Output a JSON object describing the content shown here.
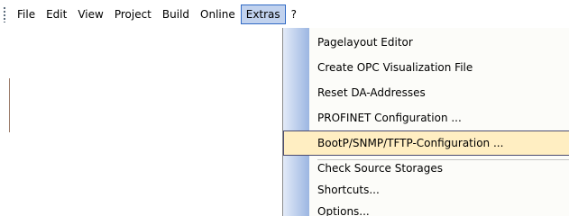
{
  "menubar": {
    "items": [
      {
        "label": "File"
      },
      {
        "label": "Edit"
      },
      {
        "label": "View"
      },
      {
        "label": "Project"
      },
      {
        "label": "Build"
      },
      {
        "label": "Online"
      },
      {
        "label": "Extras",
        "active": true
      },
      {
        "label": "?"
      }
    ]
  },
  "extras_menu": {
    "items": [
      {
        "label": "Pagelayout Editor"
      },
      {
        "label": "Create OPC Visualization File"
      },
      {
        "label": "Reset DA-Addresses"
      },
      {
        "label": "PROFINET Configuration ..."
      },
      {
        "label": "BootP/SNMP/TFTP-Configuration ...",
        "highlighted": true
      },
      {
        "label": "Check Source Storages"
      },
      {
        "label": "Shortcuts..."
      },
      {
        "label": "Options..."
      }
    ]
  },
  "colors": {
    "menu_highlight": "#ffeec2",
    "active_menu_bg": "#c1d2ee",
    "gutter_dark": "#9cb6e2"
  }
}
